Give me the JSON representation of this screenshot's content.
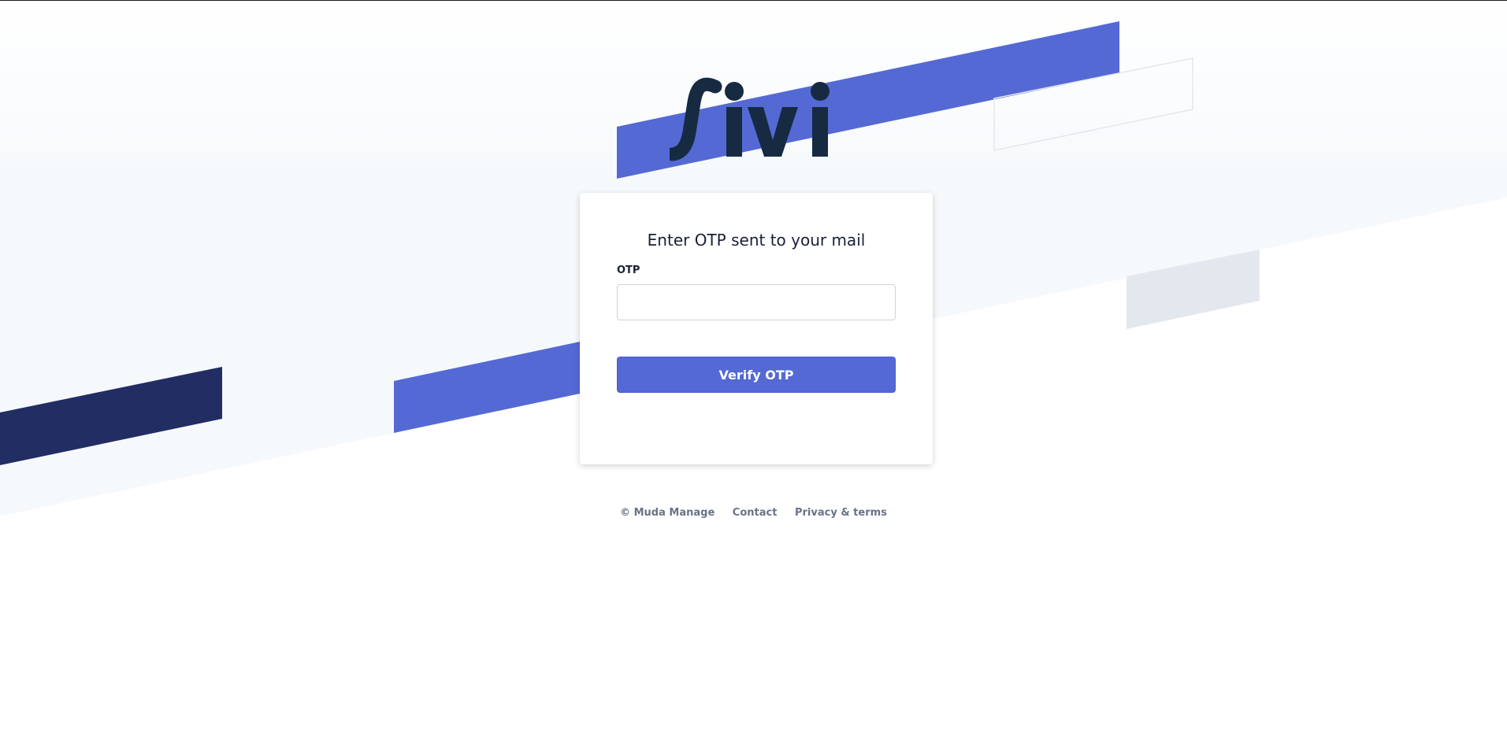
{
  "brand": {
    "logo_text": "sivi"
  },
  "colors": {
    "accent": "#5469d4",
    "navy": "#212d63",
    "logo_dark": "#162b41",
    "text_muted": "#697386"
  },
  "otp_form": {
    "title": "Enter OTP sent to your mail",
    "otp_label": "OTP",
    "otp_value": "",
    "otp_placeholder": "",
    "submit_label": "Verify OTP"
  },
  "footer": {
    "copyright": "© Muda Manage",
    "contact_label": "Contact",
    "privacy_label": "Privacy & terms"
  }
}
